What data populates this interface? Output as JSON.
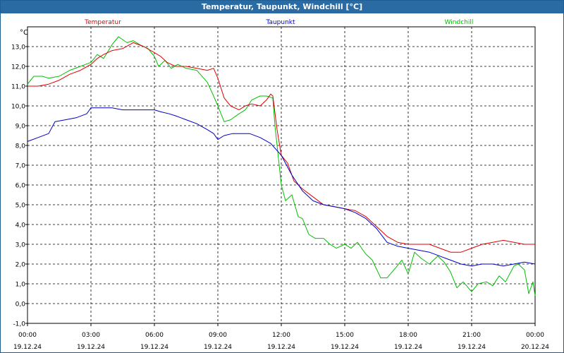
{
  "window": {
    "title": "Temperatur, Taupunkt, Windchill [°C]"
  },
  "chart_data": {
    "type": "line",
    "title": "Temperatur, Taupunkt, Windchill [°C]",
    "ylabel": "°C",
    "ylim": [
      -1.0,
      14.0
    ],
    "xlim": [
      0,
      24
    ],
    "grid": true,
    "legend": "top",
    "y_ticks": [
      "-1,0",
      "0,0",
      "1,0",
      "2,0",
      "3,0",
      "4,0",
      "5,0",
      "6,0",
      "7,0",
      "8,0",
      "9,0",
      "10,0",
      "11,0",
      "12,0",
      "13,0"
    ],
    "y_tick_values": [
      -1,
      0,
      1,
      2,
      3,
      4,
      5,
      6,
      7,
      8,
      9,
      10,
      11,
      12,
      13
    ],
    "x_tick_values": [
      0,
      3,
      6,
      9,
      12,
      15,
      18,
      21,
      24
    ],
    "x_ticks": [
      {
        "time": "00:00",
        "date": "19.12.24"
      },
      {
        "time": "03:00",
        "date": "19.12.24"
      },
      {
        "time": "06:00",
        "date": "19.12.24"
      },
      {
        "time": "09:00",
        "date": "19.12.24"
      },
      {
        "time": "12:00",
        "date": "19.12.24"
      },
      {
        "time": "15:00",
        "date": "19.12.24"
      },
      {
        "time": "18:00",
        "date": "19.12.24"
      },
      {
        "time": "21:00",
        "date": "19.12.24"
      },
      {
        "time": "00:00",
        "date": "20.12.24"
      }
    ],
    "series": [
      {
        "name": "Temperatur",
        "color": "#e00000",
        "points": [
          [
            0,
            11.0
          ],
          [
            0.5,
            11.0
          ],
          [
            1,
            11.1
          ],
          [
            1.5,
            11.3
          ],
          [
            2,
            11.6
          ],
          [
            2.5,
            11.8
          ],
          [
            3,
            12.1
          ],
          [
            3.3,
            12.4
          ],
          [
            3.6,
            12.6
          ],
          [
            4,
            12.8
          ],
          [
            4.5,
            12.9
          ],
          [
            5,
            13.2
          ],
          [
            5.5,
            13.0
          ],
          [
            6,
            12.7
          ],
          [
            6.3,
            12.5
          ],
          [
            6.6,
            12.2
          ],
          [
            7,
            12.0
          ],
          [
            7.5,
            12.0
          ],
          [
            8,
            11.9
          ],
          [
            8.5,
            11.8
          ],
          [
            8.8,
            11.9
          ],
          [
            9,
            11.4
          ],
          [
            9.3,
            10.4
          ],
          [
            9.6,
            10.0
          ],
          [
            10,
            9.8
          ],
          [
            10.3,
            10.0
          ],
          [
            10.6,
            10.1
          ],
          [
            11,
            10.0
          ],
          [
            11.3,
            10.3
          ],
          [
            11.5,
            10.6
          ],
          [
            11.6,
            10.5
          ],
          [
            11.8,
            8.8
          ],
          [
            12,
            7.5
          ],
          [
            12.3,
            7.1
          ],
          [
            12.6,
            6.2
          ],
          [
            13,
            5.8
          ],
          [
            13.5,
            5.4
          ],
          [
            14,
            5.0
          ],
          [
            14.5,
            4.9
          ],
          [
            15,
            4.8
          ],
          [
            15.5,
            4.7
          ],
          [
            16,
            4.4
          ],
          [
            16.5,
            3.9
          ],
          [
            17,
            3.4
          ],
          [
            17.5,
            3.1
          ],
          [
            18,
            3.0
          ],
          [
            18.5,
            3.0
          ],
          [
            19,
            3.0
          ],
          [
            19.5,
            2.8
          ],
          [
            20,
            2.6
          ],
          [
            20.5,
            2.6
          ],
          [
            21,
            2.8
          ],
          [
            21.5,
            3.0
          ],
          [
            22,
            3.1
          ],
          [
            22.5,
            3.2
          ],
          [
            23,
            3.1
          ],
          [
            23.5,
            3.0
          ],
          [
            24,
            3.0
          ]
        ]
      },
      {
        "name": "Taupunkt",
        "color": "#0000c8",
        "points": [
          [
            0,
            8.2
          ],
          [
            0.5,
            8.4
          ],
          [
            1,
            8.6
          ],
          [
            1.3,
            9.2
          ],
          [
            1.8,
            9.3
          ],
          [
            2.3,
            9.4
          ],
          [
            2.8,
            9.6
          ],
          [
            3,
            9.9
          ],
          [
            3.5,
            9.9
          ],
          [
            4,
            9.9
          ],
          [
            4.5,
            9.8
          ],
          [
            5,
            9.8
          ],
          [
            5.5,
            9.8
          ],
          [
            6,
            9.8
          ],
          [
            6.3,
            9.7
          ],
          [
            6.7,
            9.6
          ],
          [
            7,
            9.5
          ],
          [
            7.5,
            9.3
          ],
          [
            8,
            9.1
          ],
          [
            8.5,
            8.8
          ],
          [
            8.8,
            8.6
          ],
          [
            9,
            8.3
          ],
          [
            9.3,
            8.5
          ],
          [
            9.7,
            8.6
          ],
          [
            10,
            8.6
          ],
          [
            10.5,
            8.6
          ],
          [
            11,
            8.4
          ],
          [
            11.5,
            8.1
          ],
          [
            12,
            7.5
          ],
          [
            12.5,
            6.5
          ],
          [
            13,
            5.7
          ],
          [
            13.5,
            5.2
          ],
          [
            14,
            5.0
          ],
          [
            14.5,
            4.9
          ],
          [
            15,
            4.8
          ],
          [
            15.5,
            4.6
          ],
          [
            16,
            4.3
          ],
          [
            16.5,
            3.8
          ],
          [
            17,
            3.1
          ],
          [
            17.5,
            2.9
          ],
          [
            18,
            2.8
          ],
          [
            18.5,
            2.7
          ],
          [
            19,
            2.6
          ],
          [
            19.5,
            2.4
          ],
          [
            20,
            2.2
          ],
          [
            20.5,
            2.0
          ],
          [
            21,
            1.9
          ],
          [
            21.5,
            2.0
          ],
          [
            22,
            2.0
          ],
          [
            22.5,
            1.9
          ],
          [
            23,
            2.0
          ],
          [
            23.5,
            2.1
          ],
          [
            24,
            2.0
          ]
        ]
      },
      {
        "name": "Windchill",
        "color": "#00c000",
        "points": [
          [
            0,
            11.1
          ],
          [
            0.3,
            11.5
          ],
          [
            0.7,
            11.5
          ],
          [
            1,
            11.4
          ],
          [
            1.5,
            11.5
          ],
          [
            2,
            11.8
          ],
          [
            2.5,
            12.0
          ],
          [
            3,
            12.2
          ],
          [
            3.3,
            12.6
          ],
          [
            3.6,
            12.4
          ],
          [
            4,
            13.1
          ],
          [
            4.3,
            13.5
          ],
          [
            4.7,
            13.2
          ],
          [
            5,
            13.3
          ],
          [
            5.3,
            13.1
          ],
          [
            5.7,
            12.9
          ],
          [
            6,
            12.5
          ],
          [
            6.2,
            12.0
          ],
          [
            6.5,
            12.3
          ],
          [
            6.8,
            11.9
          ],
          [
            7.1,
            12.1
          ],
          [
            7.5,
            11.9
          ],
          [
            8,
            11.8
          ],
          [
            8.5,
            11.2
          ],
          [
            8.8,
            10.5
          ],
          [
            9,
            10.0
          ],
          [
            9.3,
            9.2
          ],
          [
            9.6,
            9.3
          ],
          [
            10,
            9.6
          ],
          [
            10.3,
            9.8
          ],
          [
            10.6,
            10.3
          ],
          [
            11,
            10.5
          ],
          [
            11.3,
            10.5
          ],
          [
            11.6,
            10.4
          ],
          [
            11.7,
            9.0
          ],
          [
            11.9,
            7.0
          ],
          [
            12,
            6.0
          ],
          [
            12.2,
            5.2
          ],
          [
            12.5,
            5.5
          ],
          [
            12.8,
            4.4
          ],
          [
            13,
            4.3
          ],
          [
            13.3,
            3.5
          ],
          [
            13.6,
            3.3
          ],
          [
            14,
            3.3
          ],
          [
            14.3,
            3.0
          ],
          [
            14.6,
            2.8
          ],
          [
            15,
            3.0
          ],
          [
            15.3,
            2.8
          ],
          [
            15.6,
            3.1
          ],
          [
            16,
            2.5
          ],
          [
            16.3,
            2.2
          ],
          [
            16.7,
            1.3
          ],
          [
            17,
            1.3
          ],
          [
            17.4,
            1.8
          ],
          [
            17.7,
            2.2
          ],
          [
            18,
            1.5
          ],
          [
            18.3,
            2.6
          ],
          [
            18.6,
            2.3
          ],
          [
            19,
            2.0
          ],
          [
            19.4,
            2.4
          ],
          [
            19.7,
            2.1
          ],
          [
            20,
            1.6
          ],
          [
            20.3,
            0.8
          ],
          [
            20.6,
            1.1
          ],
          [
            21,
            0.6
          ],
          [
            21.3,
            1.0
          ],
          [
            21.7,
            1.1
          ],
          [
            22,
            0.9
          ],
          [
            22.3,
            1.4
          ],
          [
            22.6,
            1.1
          ],
          [
            23,
            1.9
          ],
          [
            23.2,
            2.0
          ],
          [
            23.5,
            1.7
          ],
          [
            23.7,
            0.5
          ],
          [
            23.9,
            1.1
          ],
          [
            24,
            0.4
          ]
        ]
      }
    ]
  }
}
